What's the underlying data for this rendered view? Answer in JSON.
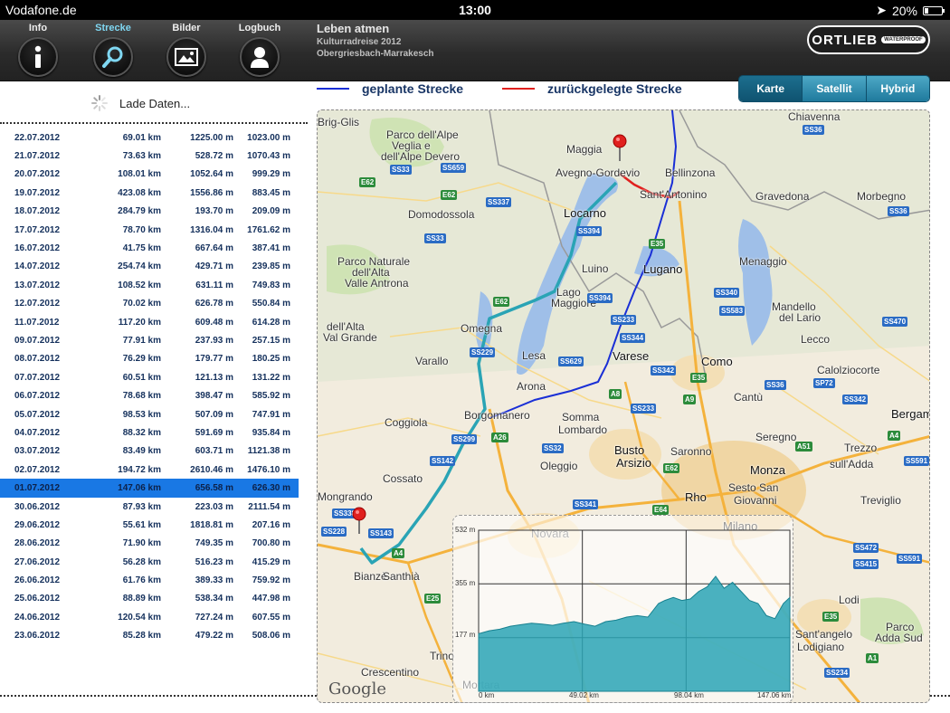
{
  "status": {
    "carrier": "Vodafone.de",
    "time": "13:00",
    "battery": "20%",
    "battery_level": 0.2
  },
  "nav": [
    {
      "label": "Info",
      "icon": "info-icon"
    },
    {
      "label": "Strecke",
      "icon": "magnifier-icon",
      "active": true
    },
    {
      "label": "Bilder",
      "icon": "picture-icon"
    },
    {
      "label": "Logbuch",
      "icon": "person-icon"
    }
  ],
  "trip": {
    "title": "Leben atmen",
    "subtitle": "Kulturradreise 2012",
    "route": "Obergriesbach-Marrakesch"
  },
  "brand": {
    "logo": "ORTLIEB",
    "tag": "WATERPROOF"
  },
  "loading_text": "Lade Daten...",
  "legend": {
    "planned": "geplante Strecke",
    "traveled": "zurückgelegte Strecke",
    "planned_color": "#1a2fd6",
    "traveled_color": "#e0201e"
  },
  "map_types": [
    "Karte",
    "Satellit",
    "Hybrid"
  ],
  "days": [
    [
      "22.07.2012",
      "69.01 km",
      "1225.00 m",
      "1023.00 m"
    ],
    [
      "21.07.2012",
      "73.63 km",
      "528.72 m",
      "1070.43 m"
    ],
    [
      "20.07.2012",
      "108.01 km",
      "1052.64 m",
      "999.29 m"
    ],
    [
      "19.07.2012",
      "423.08 km",
      "1556.86 m",
      "883.45 m"
    ],
    [
      "18.07.2012",
      "284.79 km",
      "193.70 m",
      "209.09 m"
    ],
    [
      "17.07.2012",
      "78.70 km",
      "1316.04 m",
      "1761.62 m"
    ],
    [
      "16.07.2012",
      "41.75 km",
      "667.64 m",
      "387.41 m"
    ],
    [
      "14.07.2012",
      "254.74 km",
      "429.71 m",
      "239.85 m"
    ],
    [
      "13.07.2012",
      "108.52 km",
      "631.11 m",
      "749.83 m"
    ],
    [
      "12.07.2012",
      "70.02 km",
      "626.78 m",
      "550.84 m"
    ],
    [
      "11.07.2012",
      "117.20 km",
      "609.48 m",
      "614.28 m"
    ],
    [
      "09.07.2012",
      "77.91 km",
      "237.93 m",
      "257.15 m"
    ],
    [
      "08.07.2012",
      "76.29 km",
      "179.77 m",
      "180.25 m"
    ],
    [
      "07.07.2012",
      "60.51 km",
      "121.13 m",
      "131.22 m"
    ],
    [
      "06.07.2012",
      "78.68 km",
      "398.47 m",
      "585.92 m"
    ],
    [
      "05.07.2012",
      "98.53 km",
      "507.09 m",
      "747.91 m"
    ],
    [
      "04.07.2012",
      "88.32 km",
      "591.69 m",
      "935.84 m"
    ],
    [
      "03.07.2012",
      "83.49 km",
      "603.71 m",
      "1121.38 m"
    ],
    [
      "02.07.2012",
      "194.72 km",
      "2610.46 m",
      "1476.10 m"
    ],
    [
      "01.07.2012",
      "147.06 km",
      "656.58 m",
      "626.30 m"
    ],
    [
      "30.06.2012",
      "87.93 km",
      "223.03 m",
      "2111.54 m"
    ],
    [
      "29.06.2012",
      "55.61 km",
      "1818.81 m",
      "207.16 m"
    ],
    [
      "28.06.2012",
      "71.90 km",
      "749.35 m",
      "700.80 m"
    ],
    [
      "27.06.2012",
      "56.28 km",
      "516.23 m",
      "415.29 m"
    ],
    [
      "26.06.2012",
      "61.76 km",
      "389.33 m",
      "759.92 m"
    ],
    [
      "25.06.2012",
      "88.89 km",
      "538.34 m",
      "447.98 m"
    ],
    [
      "24.06.2012",
      "120.54 km",
      "727.24 m",
      "607.55 m"
    ],
    [
      "23.06.2012",
      "85.28 km",
      "479.22 m",
      "508.06 m"
    ]
  ],
  "selected_day": "01.07.2012",
  "map": {
    "attribution": "Google",
    "places": [
      [
        "Brig-Glis",
        0,
        6
      ],
      [
        "Parco dell'Alpe",
        76,
        20
      ],
      [
        "Veglia e",
        82,
        32
      ],
      [
        "dell'Alpe Devero",
        70,
        44
      ],
      [
        "Maggia",
        275,
        36
      ],
      [
        "Avegno-Gordevio",
        263,
        62
      ],
      [
        "Bellinzona",
        384,
        62
      ],
      [
        "Chiavenna",
        520,
        0
      ],
      [
        "Locarno",
        272,
        106
      ],
      [
        "Sant'Antonino",
        356,
        86
      ],
      [
        "Gravedona",
        484,
        88
      ],
      [
        "Morbegno",
        596,
        88
      ],
      [
        "Domodossola",
        100,
        108
      ],
      [
        "Luino",
        292,
        168
      ],
      [
        "Lugano",
        360,
        168
      ],
      [
        "Menaggio",
        466,
        160
      ],
      [
        "Parco Naturale",
        22,
        160
      ],
      [
        "dell'Alta",
        38,
        172
      ],
      [
        "Valle Antrona",
        30,
        184
      ],
      [
        "Lago",
        264,
        194
      ],
      [
        "Maggiore",
        258,
        206
      ],
      [
        "Mandello",
        502,
        210
      ],
      [
        "del Lario",
        510,
        222
      ],
      [
        "Omegna",
        158,
        234
      ],
      [
        "dell'Alta",
        10,
        232
      ],
      [
        "Val Grande",
        6,
        244
      ],
      [
        "Lecco",
        534,
        246
      ],
      [
        "Lesa",
        226,
        264
      ],
      [
        "Varese",
        326,
        264
      ],
      [
        "Como",
        424,
        270
      ],
      [
        "Varallo",
        108,
        270
      ],
      [
        "Calolziocorte",
        552,
        280
      ],
      [
        "Arona",
        220,
        298
      ],
      [
        "Cantù",
        460,
        310
      ],
      [
        "Coggiola",
        74,
        338
      ],
      [
        "Borgomanero",
        162,
        330
      ],
      [
        "Somma",
        270,
        332
      ],
      [
        "Lombardo",
        266,
        346
      ],
      [
        "Seregno",
        484,
        354
      ],
      [
        "Bergamo",
        634,
        328
      ],
      [
        "Busto",
        328,
        368
      ],
      [
        "Arsizio",
        330,
        382
      ],
      [
        "Saronno",
        390,
        370
      ],
      [
        "Oleggio",
        246,
        386
      ],
      [
        "Monza",
        478,
        390
      ],
      [
        "Trezzo",
        582,
        366
      ],
      [
        "sull'Adda",
        566,
        384
      ],
      [
        "Cossato",
        72,
        400
      ],
      [
        "Rho",
        406,
        420
      ],
      [
        "Sesto San",
        454,
        410
      ],
      [
        "Giovanni",
        460,
        424
      ],
      [
        "Treviglio",
        600,
        424
      ],
      [
        "Mongrando",
        0,
        420
      ],
      [
        "Milano",
        448,
        452
      ],
      [
        "Novara",
        236,
        460
      ],
      [
        "Lodi",
        576,
        534
      ],
      [
        "Bianzè",
        40,
        508
      ],
      [
        "Santhià",
        72,
        508
      ],
      [
        "Parco",
        628,
        564
      ],
      [
        "Adda Sud",
        616,
        576
      ],
      [
        "Sant'angelo",
        528,
        572
      ],
      [
        "Lodigiano",
        530,
        586
      ],
      [
        "Crescentino",
        48,
        614
      ],
      [
        "Trino",
        124,
        596
      ],
      [
        "Mortara",
        160,
        628
      ]
    ],
    "big_places": [
      "Locarno",
      "Lugano",
      "Varese",
      "Como",
      "Busto",
      "Arsizio",
      "Monza",
      "Milano",
      "Novara",
      "Rho",
      "Bergamo"
    ],
    "shields": [
      [
        "SS36",
        536,
        16,
        "b"
      ],
      [
        "SS33",
        80,
        60,
        "b"
      ],
      [
        "SS659",
        136,
        58,
        "b"
      ],
      [
        "E62",
        46,
        74,
        "g"
      ],
      [
        "E62",
        136,
        88,
        "g"
      ],
      [
        "SS337",
        186,
        96,
        "b"
      ],
      [
        "SS36",
        630,
        106,
        "b"
      ],
      [
        "SS394",
        286,
        128,
        "b"
      ],
      [
        "SS33",
        118,
        136,
        "b"
      ],
      [
        "E35",
        366,
        142,
        "g"
      ],
      [
        "E62",
        194,
        206,
        "g"
      ],
      [
        "SS394",
        298,
        202,
        "b"
      ],
      [
        "SS340",
        438,
        196,
        "b"
      ],
      [
        "SS583",
        444,
        216,
        "b"
      ],
      [
        "SS470",
        624,
        228,
        "b"
      ],
      [
        "SS233",
        324,
        226,
        "b"
      ],
      [
        "SS344",
        334,
        246,
        "b"
      ],
      [
        "SS229",
        168,
        262,
        "b"
      ],
      [
        "SS629",
        266,
        272,
        "b"
      ],
      [
        "SS342",
        368,
        282,
        "b"
      ],
      [
        "E35",
        412,
        290,
        "g"
      ],
      [
        "SS36",
        494,
        298,
        "b"
      ],
      [
        "SP72",
        548,
        296,
        "b"
      ],
      [
        "A8",
        322,
        308,
        "g"
      ],
      [
        "A9",
        404,
        314,
        "g"
      ],
      [
        "SS342",
        580,
        314,
        "b"
      ],
      [
        "SS233",
        346,
        324,
        "b"
      ],
      [
        "SS299",
        148,
        358,
        "b"
      ],
      [
        "A26",
        192,
        356,
        "g"
      ],
      [
        "A4",
        630,
        354,
        "g"
      ],
      [
        "SS32",
        248,
        368,
        "b"
      ],
      [
        "SS142",
        124,
        382,
        "b"
      ],
      [
        "A51",
        528,
        366,
        "g"
      ],
      [
        "SS591",
        648,
        382,
        "b"
      ],
      [
        "E62",
        382,
        390,
        "g"
      ],
      [
        "SS338",
        16,
        440,
        "b"
      ],
      [
        "SS341",
        282,
        430,
        "b"
      ],
      [
        "E64",
        370,
        436,
        "g"
      ],
      [
        "SS228",
        4,
        460,
        "b"
      ],
      [
        "SS143",
        56,
        462,
        "b"
      ],
      [
        "A4",
        82,
        484,
        "g"
      ],
      [
        "SS472",
        592,
        478,
        "b"
      ],
      [
        "SS591",
        640,
        490,
        "b"
      ],
      [
        "SS415",
        592,
        496,
        "b"
      ],
      [
        "E25",
        118,
        534,
        "g"
      ],
      [
        "E35",
        558,
        554,
        "g"
      ],
      [
        "A1",
        606,
        600,
        "g"
      ],
      [
        "SS234",
        560,
        616,
        "b"
      ]
    ],
    "traveled_route": [
      [
        10,
        20
      ],
      [
        28,
        25
      ],
      [
        52,
        35
      ],
      [
        78,
        48
      ],
      [
        95,
        60
      ],
      [
        105,
        90
      ],
      [
        115,
        110
      ],
      [
        120,
        130
      ]
    ],
    "planned_route": [
      [
        392,
        0
      ],
      [
        396,
        40
      ],
      [
        392,
        80
      ],
      [
        380,
        120
      ],
      [
        368,
        160
      ],
      [
        350,
        200
      ],
      [
        334,
        240
      ],
      [
        320,
        280
      ],
      [
        310,
        300
      ],
      [
        280,
        310
      ],
      [
        240,
        320
      ],
      [
        206,
        334
      ],
      [
        190,
        340
      ]
    ],
    "traveled_pin": [
      334,
      56
    ],
    "start_pin": [
      46,
      468
    ]
  },
  "elevation": {
    "y_labels": [
      "532 m",
      "355 m",
      "177 m"
    ],
    "x_labels": [
      "0 km",
      "49.02 km",
      "98.04 km",
      "147.06 km"
    ],
    "distance_km": [
      0,
      5,
      10,
      15,
      20,
      25,
      30,
      35,
      40,
      45,
      50,
      55,
      60,
      65,
      70,
      75,
      80,
      85,
      88,
      92,
      96,
      100,
      104,
      108,
      112,
      116,
      120,
      124,
      128,
      132,
      136,
      140,
      144,
      147.06
    ],
    "altitude_m": [
      190,
      200,
      205,
      215,
      220,
      225,
      222,
      218,
      225,
      230,
      222,
      215,
      230,
      235,
      245,
      250,
      245,
      290,
      300,
      310,
      300,
      305,
      330,
      345,
      380,
      340,
      360,
      330,
      300,
      290,
      250,
      240,
      290,
      310
    ],
    "y_max": 532,
    "x_max": 147.06,
    "fill_color": "#2aa4b5"
  }
}
